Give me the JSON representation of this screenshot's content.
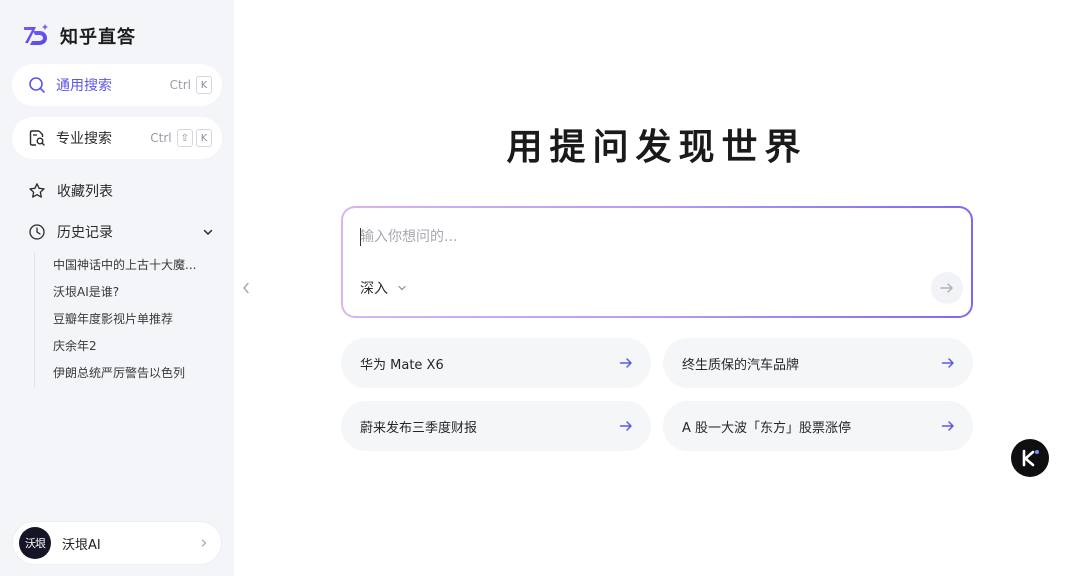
{
  "app": {
    "name": "知乎直答"
  },
  "sidebar": {
    "general_search": {
      "label": "通用搜索",
      "shortcut_mod": "Ctrl",
      "shortcut_key": "K"
    },
    "pro_search": {
      "label": "专业搜索",
      "shortcut_mod": "Ctrl",
      "shortcut_shift": "⇧",
      "shortcut_key": "K"
    },
    "favorites": {
      "label": "收藏列表"
    },
    "history": {
      "label": "历史记录",
      "items": [
        "中国神话中的上古十大魔...",
        "沃垠AI是谁?",
        "豆瓣年度影视片单推荐",
        "庆余年2",
        "伊朗总统严厉警告以色列"
      ]
    },
    "user": {
      "avatar_text": "沃垠",
      "name": "沃垠AI"
    }
  },
  "main": {
    "hero_title": "用提问发现世界",
    "input": {
      "placeholder": "输入你想问的...",
      "value": ""
    },
    "mode": "深入",
    "suggestions": [
      "华为 Mate X6",
      "终生质保的汽车品牌",
      "蔚来发布三季度财报",
      "A 股一大波「东方」股票涨停"
    ]
  },
  "colors": {
    "accent": "#5b58e6",
    "sidebar_bg": "#f4f5f8",
    "suggestion_bg": "#f5f6f8",
    "gradient_start": "#d8b6ef",
    "gradient_end": "#7c6bf0"
  }
}
